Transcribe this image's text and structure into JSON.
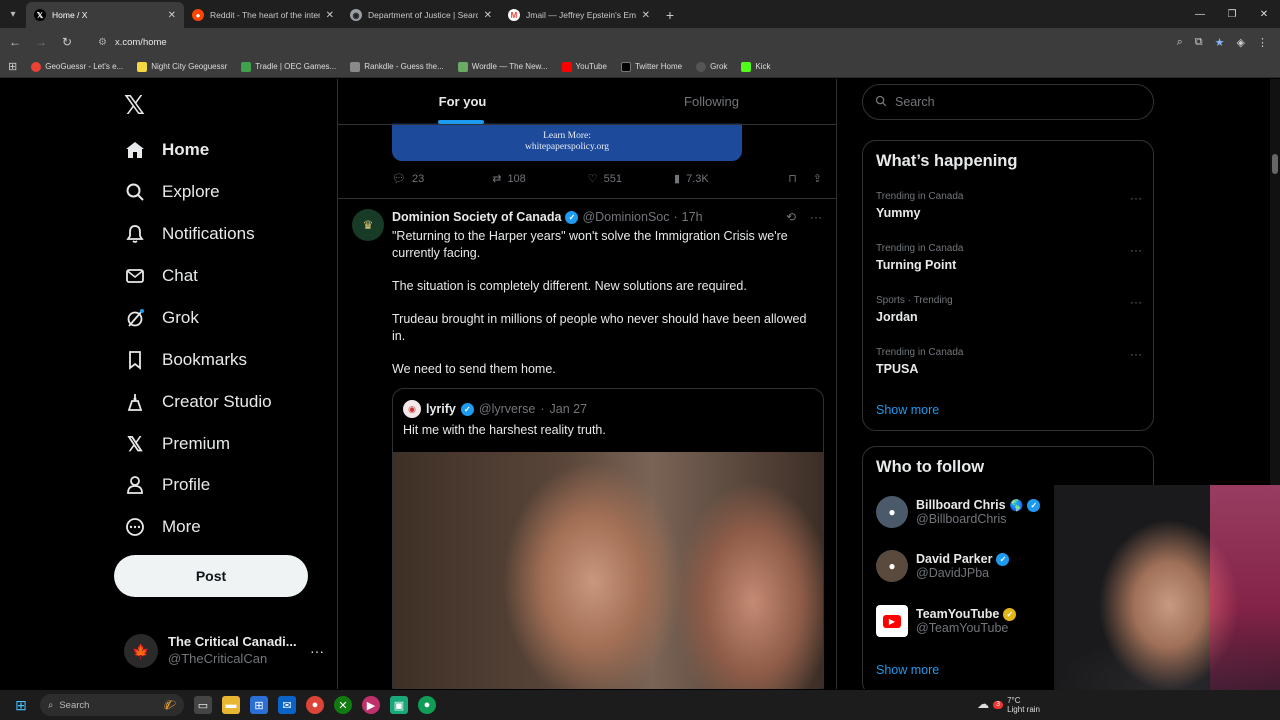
{
  "browser": {
    "tabs": [
      {
        "title": "Home / X",
        "active": true,
        "icon": "x-logo-icon",
        "color": "#000000"
      },
      {
        "title": "Reddit - The heart of the intern",
        "active": false,
        "icon": "reddit-icon",
        "color": "#ff4500"
      },
      {
        "title": "Department of Justice | Search",
        "active": false,
        "icon": "doj-icon",
        "color": "#9aa0a6"
      },
      {
        "title": "Jmail — Jeffrey Epstein's Emails",
        "active": false,
        "icon": "gmail-icon",
        "color": "#ea4335"
      }
    ],
    "url": "x.com/home",
    "bookmarks": [
      {
        "label": "GeoGuessr - Let's e...",
        "color": "#ea4335"
      },
      {
        "label": "Night City Geoguessr",
        "color": "#f5d742"
      },
      {
        "label": "Tradle | OEC Games...",
        "color": "#3fa34d"
      },
      {
        "label": "Rankdle - Guess the...",
        "color": "#8a8a8a"
      },
      {
        "label": "Wordle — The New...",
        "color": "#6aaa64"
      },
      {
        "label": "YouTube",
        "color": "#ff0000"
      },
      {
        "label": "Twitter Home",
        "color": "#000000"
      },
      {
        "label": "Grok",
        "color": "#555555"
      },
      {
        "label": "Kick",
        "color": "#53fc18"
      }
    ]
  },
  "nav": {
    "items": [
      {
        "label": "Home",
        "icon": "home-icon"
      },
      {
        "label": "Explore",
        "icon": "search-icon"
      },
      {
        "label": "Notifications",
        "icon": "bell-icon"
      },
      {
        "label": "Chat",
        "icon": "mail-icon"
      },
      {
        "label": "Grok",
        "icon": "grok-icon"
      },
      {
        "label": "Bookmarks",
        "icon": "bookmark-icon"
      },
      {
        "label": "Creator Studio",
        "icon": "creator-studio-icon"
      },
      {
        "label": "Premium",
        "icon": "x-premium-icon"
      },
      {
        "label": "Profile",
        "icon": "person-icon"
      },
      {
        "label": "More",
        "icon": "more-circle-icon"
      }
    ],
    "post_label": "Post",
    "account": {
      "name": "The Critical Canadi...",
      "handle": "@TheCriticalCan"
    }
  },
  "feed": {
    "tabs": [
      "For you",
      "Following"
    ],
    "prev_ad": {
      "line1": "Learn More:",
      "line2": "whitepaperspolicy.org"
    },
    "prev_stats": {
      "replies": "23",
      "reposts": "108",
      "likes": "551",
      "views": "7.3K"
    },
    "tweet": {
      "name": "Dominion Society of Canada",
      "handle": "@DominionSoc",
      "time": "17h",
      "paragraphs": [
        "\"Returning to the Harper years\" won't solve the Immigration Crisis we're currently facing.",
        "The situation is completely different. New solutions are required.",
        "Trudeau brought in millions of people who never should have been allowed in.",
        "We need to send them home."
      ],
      "quote": {
        "name": "lyrify",
        "handle": "@lyrverse",
        "date": "Jan 27",
        "text": "Hit me with the harshest reality truth."
      }
    }
  },
  "sidebar": {
    "search_placeholder": "Search",
    "trending_title": "What’s happening",
    "trends": [
      {
        "context": "Trending in Canada",
        "name": "Yummy"
      },
      {
        "context": "Trending in Canada",
        "name": "Turning Point"
      },
      {
        "context": "Sports · Trending",
        "name": "Jordan"
      },
      {
        "context": "Trending in Canada",
        "name": "TPUSA"
      }
    ],
    "show_more": "Show more",
    "follow_title": "Who to follow",
    "follows": [
      {
        "name": "Billboard Chris",
        "handle": "@BillboardChris",
        "badge": "blue"
      },
      {
        "name": "David Parker",
        "handle": "@DavidJPba",
        "badge": "blue"
      },
      {
        "name": "TeamYouTube",
        "handle": "@TeamYouTube",
        "badge": "gold"
      }
    ],
    "follow_show_more": "Show more"
  },
  "taskbar": {
    "search_placeholder": "Search",
    "weather_temp": "7°C",
    "weather_desc": "Light rain",
    "weather_badge": "3"
  },
  "colors": {
    "accent": "#1d9bf0",
    "background": "#000000",
    "border": "#2f3336"
  }
}
